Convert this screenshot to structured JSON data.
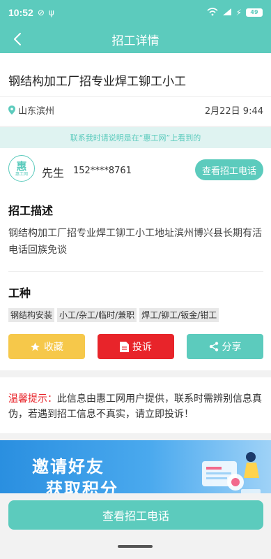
{
  "status_bar": {
    "time": "10:52",
    "battery": "49"
  },
  "nav": {
    "title": "招工详情"
  },
  "job": {
    "title": "钢结构加工厂招专业焊工铆工小工",
    "location": "山东滨州",
    "posted_time": "2月22日 9:44"
  },
  "notice": "联系我时请说明是在“惠工网”上看到的",
  "contact": {
    "avatar_main": "惠",
    "avatar_sub": "惠工网",
    "name": "先生",
    "phone": "152****8761",
    "view_phone_label": "查看招工电话"
  },
  "description": {
    "heading": "招工描述",
    "text": "钢结构加工厂招专业焊工铆工小工地址滨州博兴县长期有活电话回族免谈"
  },
  "work_types": {
    "heading": "工种",
    "tags": [
      "钢结构安装",
      "小工/杂工/临时/兼职",
      "焊工/铆工/钣金/钳工"
    ]
  },
  "actions": {
    "favorite": "收藏",
    "report": "投诉",
    "share": "分享",
    "colors": {
      "favorite": "#f6c84a",
      "report": "#e8242a",
      "share": "#5ccbbd"
    }
  },
  "tip": {
    "label": "温馨提示：",
    "text": "此信息由惠工网用户提供，联系时需辨别信息真伪，若遇到招工信息不真实，请立即投诉！"
  },
  "banner": {
    "line1": "邀请好友",
    "line2": "获取积分"
  },
  "bottom": {
    "button_label": "查看招工电话"
  },
  "theme": {
    "accent": "#5ccbbd"
  }
}
